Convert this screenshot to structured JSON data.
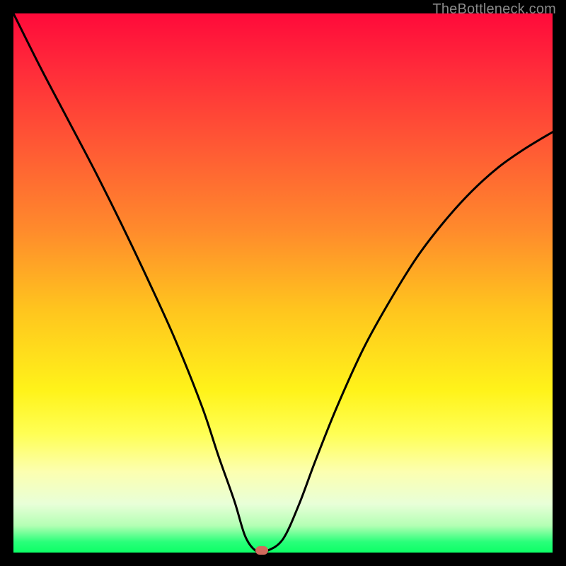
{
  "watermark": "TheBottleneck.com",
  "chart_data": {
    "type": "line",
    "title": "",
    "xlabel": "",
    "ylabel": "",
    "xlim": [
      0,
      100
    ],
    "ylim": [
      0,
      100
    ],
    "grid": false,
    "x": [
      0,
      5,
      10,
      15,
      20,
      25,
      30,
      35,
      38,
      41,
      43,
      45,
      47,
      50,
      53,
      56,
      60,
      65,
      70,
      75,
      80,
      85,
      90,
      95,
      100
    ],
    "values": [
      100,
      90,
      80.5,
      71,
      61,
      50.5,
      39.5,
      27,
      18,
      9.5,
      3,
      0.3,
      0.3,
      2.5,
      9,
      17,
      27,
      38,
      47,
      55,
      61.5,
      67,
      71.5,
      75,
      78
    ],
    "marker": {
      "x": 46,
      "y": 0.4
    }
  },
  "colors": {
    "curve": "#000000",
    "marker": "#d1695c"
  }
}
